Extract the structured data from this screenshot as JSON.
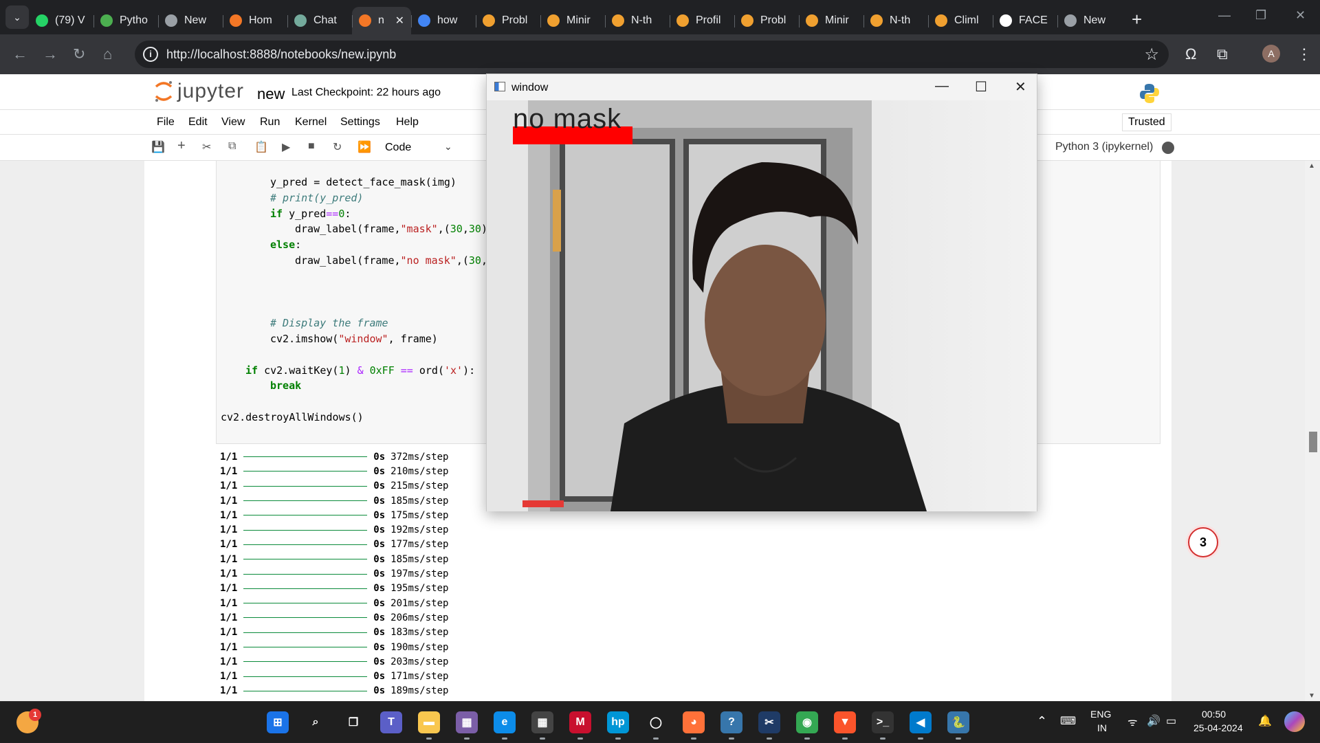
{
  "browser": {
    "tabs": [
      {
        "label": "(79) V",
        "icon": "whatsapp-icon",
        "color": "#25d366"
      },
      {
        "label": "Pytho",
        "icon": "link-icon",
        "color": "#4caf50"
      },
      {
        "label": "New",
        "icon": "chrome-icon",
        "color": "#9aa0a6"
      },
      {
        "label": "Hom",
        "icon": "jupyter-icon",
        "color": "#f37726"
      },
      {
        "label": "Chat",
        "icon": "openai-icon",
        "color": "#74aa9c"
      },
      {
        "label": "n",
        "icon": "hourglass-icon",
        "color": "#f37726",
        "active": true
      },
      {
        "label": "how",
        "icon": "google-icon",
        "color": "#4285f4"
      },
      {
        "label": "Probl",
        "icon": "codechef-icon",
        "color": "#f0a030"
      },
      {
        "label": "Minir",
        "icon": "codechef-icon",
        "color": "#f0a030"
      },
      {
        "label": "N-th",
        "icon": "codechef-icon",
        "color": "#f0a030"
      },
      {
        "label": "Profil",
        "icon": "codechef-icon",
        "color": "#f0a030"
      },
      {
        "label": "Probl",
        "icon": "codechef-icon",
        "color": "#f0a030"
      },
      {
        "label": "Minir",
        "icon": "codechef-icon",
        "color": "#f0a030"
      },
      {
        "label": "N-th",
        "icon": "codechef-icon",
        "color": "#f0a030"
      },
      {
        "label": "Climl",
        "icon": "codechef-icon",
        "color": "#f0a030"
      },
      {
        "label": "FACE",
        "icon": "medium-icon",
        "color": "#ffffff"
      },
      {
        "label": "New",
        "icon": "chrome-icon",
        "color": "#9aa0a6"
      }
    ],
    "url": "http://localhost:8888/notebooks/new.ipynb",
    "profile_initial": "A"
  },
  "jupyter": {
    "logo_text": "jupyter",
    "notebook_name": "new",
    "checkpoint": "Last Checkpoint: 22 hours ago",
    "menu": [
      "File",
      "Edit",
      "View",
      "Run",
      "Kernel",
      "Settings",
      "Help"
    ],
    "trusted": "Trusted",
    "cell_type": "Code",
    "kernel": "Python 3 (ipykernel)",
    "code_lines": [
      {
        "indent": 2,
        "html": "y_pred = detect_face_mask(img)"
      },
      {
        "indent": 2,
        "html": "<span class=\"cm\"># print(y_pred)</span>"
      },
      {
        "indent": 2,
        "html": "<span class=\"kw\">if</span> y_pred<span class=\"op\">==</span><span class=\"nm\">0</span>:"
      },
      {
        "indent": 3,
        "html": "draw_label(frame,<span class=\"st\">\"mask\"</span>,(<span class=\"nm\">30</span>,<span class=\"nm\">30</span>)"
      },
      {
        "indent": 2,
        "html": "<span class=\"kw\">else</span>:"
      },
      {
        "indent": 3,
        "html": "draw_label(frame,<span class=\"st\">\"no mask\"</span>,(<span class=\"nm\">30</span>,"
      },
      {
        "indent": 0,
        "html": ""
      },
      {
        "indent": 0,
        "html": ""
      },
      {
        "indent": 0,
        "html": ""
      },
      {
        "indent": 2,
        "html": "<span class=\"cm\"># Display the frame</span>"
      },
      {
        "indent": 2,
        "html": "cv2.imshow(<span class=\"st\">\"window\"</span>, frame)"
      },
      {
        "indent": 0,
        "html": ""
      },
      {
        "indent": 1,
        "html": "<span class=\"kw\">if</span> cv2.waitKey(<span class=\"nm\">1</span>) <span class=\"op\">&amp;</span> <span class=\"nm\">0xFF</span> <span class=\"op\">==</span> ord(<span class=\"st\">'x'</span>):"
      },
      {
        "indent": 2,
        "html": "<span class=\"kw\">break</span>"
      },
      {
        "indent": 0,
        "html": ""
      },
      {
        "indent": 0,
        "html": "cv2.destroyAllWindows()"
      }
    ],
    "output_lines": [
      {
        "step": "1/1",
        "time": "0s",
        "rate": "372ms/step"
      },
      {
        "step": "1/1",
        "time": "0s",
        "rate": "210ms/step"
      },
      {
        "step": "1/1",
        "time": "0s",
        "rate": "215ms/step"
      },
      {
        "step": "1/1",
        "time": "0s",
        "rate": "185ms/step"
      },
      {
        "step": "1/1",
        "time": "0s",
        "rate": "175ms/step"
      },
      {
        "step": "1/1",
        "time": "0s",
        "rate": "192ms/step"
      },
      {
        "step": "1/1",
        "time": "0s",
        "rate": "177ms/step"
      },
      {
        "step": "1/1",
        "time": "0s",
        "rate": "185ms/step"
      },
      {
        "step": "1/1",
        "time": "0s",
        "rate": "197ms/step"
      },
      {
        "step": "1/1",
        "time": "0s",
        "rate": "195ms/step"
      },
      {
        "step": "1/1",
        "time": "0s",
        "rate": "201ms/step"
      },
      {
        "step": "1/1",
        "time": "0s",
        "rate": "206ms/step"
      },
      {
        "step": "1/1",
        "time": "0s",
        "rate": "183ms/step"
      },
      {
        "step": "1/1",
        "time": "0s",
        "rate": "190ms/step"
      },
      {
        "step": "1/1",
        "time": "0s",
        "rate": "203ms/step"
      },
      {
        "step": "1/1",
        "time": "0s",
        "rate": "171ms/step"
      },
      {
        "step": "1/1",
        "time": "0s",
        "rate": "189ms/step"
      }
    ],
    "notification_count": "3"
  },
  "cv_window": {
    "title": "window",
    "label_text": "no mask",
    "label_color": "#ff0000"
  },
  "taskbar": {
    "weather_badge": "1",
    "apps": [
      {
        "name": "start-icon",
        "color": "#1a73e8",
        "glyph": "⊞"
      },
      {
        "name": "search-icon",
        "color": "transparent",
        "glyph": "⌕"
      },
      {
        "name": "task-view-icon",
        "color": "transparent",
        "glyph": "❐"
      },
      {
        "name": "teams-icon",
        "color": "#5b5fc7",
        "glyph": "T"
      },
      {
        "name": "file-explorer-icon",
        "color": "#f9c74f",
        "glyph": "▬"
      },
      {
        "name": "photos-icon",
        "color": "#7b5ea7",
        "glyph": "▦"
      },
      {
        "name": "edge-icon",
        "color": "#0c8ce9",
        "glyph": "e"
      },
      {
        "name": "store-icon",
        "color": "#444",
        "glyph": "▦"
      },
      {
        "name": "mcafee-icon",
        "color": "#c8102e",
        "glyph": "M"
      },
      {
        "name": "myhp-icon",
        "color": "#0096d6",
        "glyph": "hp"
      },
      {
        "name": "cortana-icon",
        "color": "transparent",
        "glyph": "◯"
      },
      {
        "name": "firefox-icon",
        "color": "#ff7139",
        "glyph": "◕"
      },
      {
        "name": "python-idle-icon",
        "color": "#3776ab",
        "glyph": "?"
      },
      {
        "name": "snipping-icon",
        "color": "#1f3b66",
        "glyph": "✂"
      },
      {
        "name": "chrome-icon",
        "color": "#34a853",
        "glyph": "◉"
      },
      {
        "name": "brave-icon",
        "color": "#fb542b",
        "glyph": "▼"
      },
      {
        "name": "terminal-icon",
        "color": "#333",
        "glyph": ">_"
      },
      {
        "name": "vscode-icon",
        "color": "#007acc",
        "glyph": "◀"
      },
      {
        "name": "python-icon",
        "color": "#3776ab",
        "glyph": "🐍"
      }
    ],
    "lang_top": "ENG",
    "lang_bottom": "IN",
    "time": "00:50",
    "date": "25-04-2024"
  }
}
